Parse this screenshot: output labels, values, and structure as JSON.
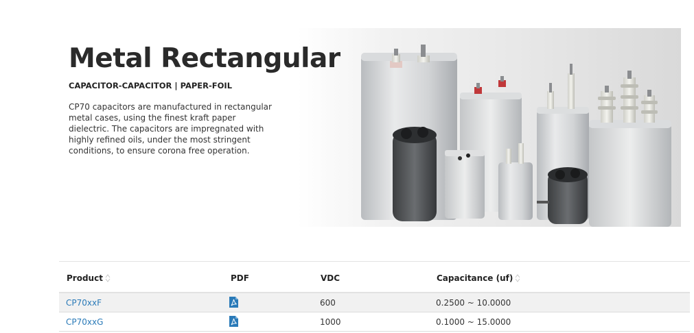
{
  "hero": {
    "title": "Metal Rectangular",
    "subtitle": "CAPACITOR-CAPACITOR | PAPER-FOIL",
    "description": "CP70 capacitors are manufactured in rectangular metal cases, using the finest kraft paper dielectric. The capacitors are impregnated with highly refined oils, under the most stringent conditions, to ensure corona free operation."
  },
  "table": {
    "headers": {
      "product": "Product",
      "pdf": "PDF",
      "vdc": "VDC",
      "capacitance": "Capacitance (uf)"
    },
    "rows": [
      {
        "product": "CP70xxF",
        "pdf_icon": "pdf-icon",
        "vdc": "600",
        "capacitance": "0.2500 ~ 10.0000"
      },
      {
        "product": "CP70xxG",
        "pdf_icon": "pdf-icon",
        "vdc": "1000",
        "capacitance": "0.1000 ~ 15.0000"
      }
    ]
  },
  "colors": {
    "link": "#2a7ab8",
    "pdf_icon": "#2a7ab8"
  }
}
